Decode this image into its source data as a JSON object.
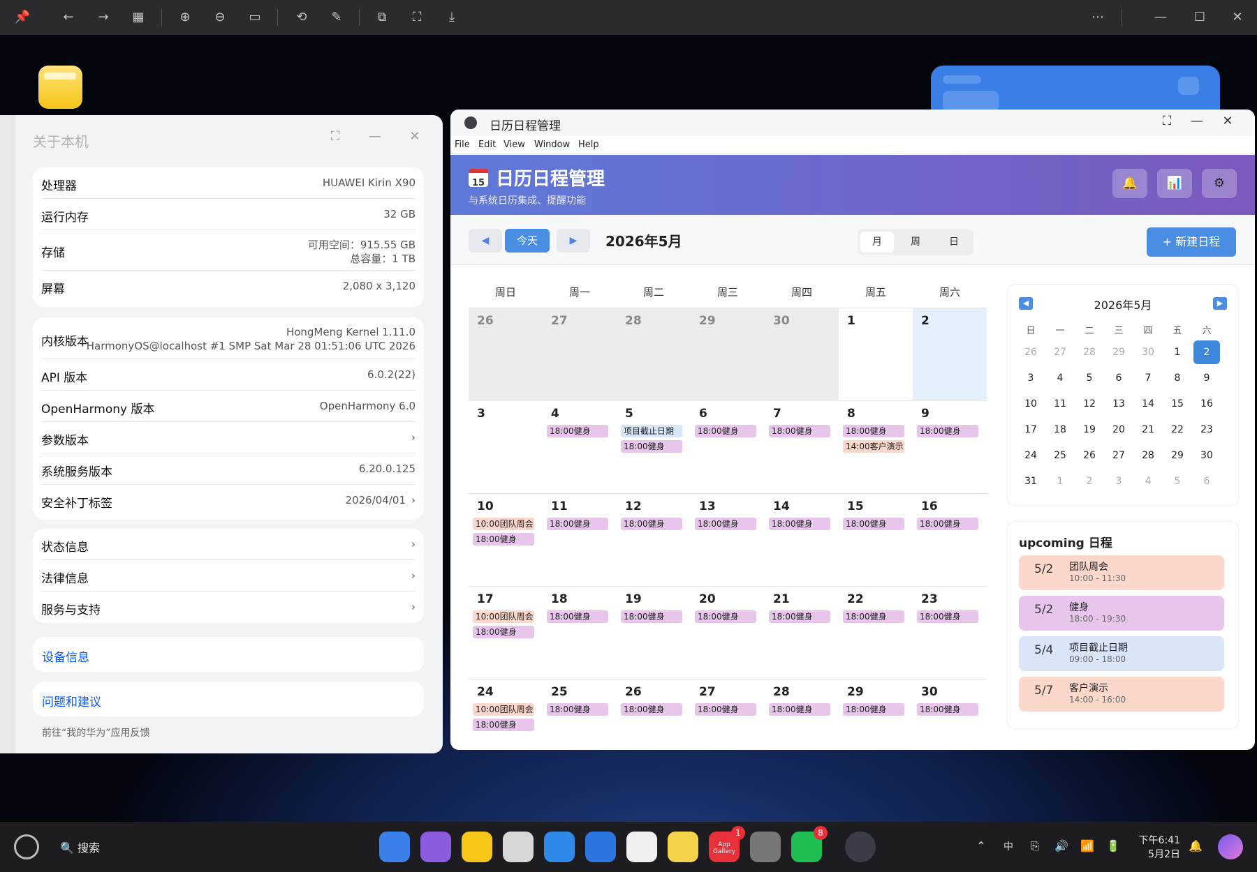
{
  "viewer_toolbar": {
    "icons": [
      "pin-icon",
      "back-icon",
      "forward-icon",
      "grid-icon",
      "zoom-in-icon",
      "zoom-out-icon",
      "fit-icon",
      "rotate-icon",
      "edit-icon",
      "crop-icon",
      "screenshot-icon",
      "download-icon",
      "more-icon",
      "minimize-icon",
      "maximize-icon",
      "close-icon"
    ]
  },
  "about": {
    "title": "关于本机",
    "card1": [
      {
        "k": "处理器",
        "v": "HUAWEI Kirin X90"
      },
      {
        "k": "运行内存",
        "v": "32 GB"
      },
      {
        "k": "存储",
        "v1": "可用空间：915.55 GB",
        "v2": "总容量：1 TB"
      },
      {
        "k": "屏幕",
        "v": "2,080 x 3,120"
      }
    ],
    "card2": [
      {
        "k": "内核版本",
        "v1": "HongMeng Kernel 1.11.0",
        "v2": "HarmonyOS@localhost #1 SMP Sat Mar 28 01:51:06 UTC 2026"
      },
      {
        "k": "API 版本",
        "v": "6.0.2(22)"
      },
      {
        "k": "OpenHarmony 版本",
        "v": "OpenHarmony 6.0"
      },
      {
        "k": "参数版本",
        "v": ""
      },
      {
        "k": "系统服务版本",
        "v": "6.20.0.125"
      },
      {
        "k": "安全补丁标签",
        "v": "2026/04/01"
      }
    ],
    "card3": [
      "状态信息",
      "法律信息",
      "服务与支持"
    ],
    "device_info": "设备信息",
    "feedback_link": "问题和建议",
    "feedback_note": "前往“我的华为”应用反馈"
  },
  "calendar": {
    "window_title": "日历日程管理",
    "menu": [
      "File",
      "Edit",
      "View",
      "Window",
      "Help"
    ],
    "logo_text": "15",
    "app_title": "日历日程管理",
    "subtitle": "与系统日历集成、提醒功能",
    "today": "今天",
    "month_title": "2026年5月",
    "views": [
      "月",
      "周",
      "日"
    ],
    "new_event": "+ 新建日程",
    "weekdays": [
      "周日",
      "周一",
      "周二",
      "周三",
      "周四",
      "周五",
      "周六"
    ],
    "weeks": [
      [
        {
          "d": "26",
          "t": "other"
        },
        {
          "d": "27",
          "t": "other"
        },
        {
          "d": "28",
          "t": "other"
        },
        {
          "d": "29",
          "t": "other"
        },
        {
          "d": "30",
          "t": "other"
        },
        {
          "d": "1"
        },
        {
          "d": "2",
          "t": "sel"
        }
      ],
      [
        {
          "d": "3"
        },
        {
          "d": "4",
          "ev": [
            [
              "gym",
              "18:00健身"
            ]
          ]
        },
        {
          "d": "5",
          "ev": [
            [
              "due",
              "项目截止日期"
            ],
            [
              "gym",
              "18:00健身"
            ]
          ]
        },
        {
          "d": "6",
          "ev": [
            [
              "gym",
              "18:00健身"
            ]
          ]
        },
        {
          "d": "7",
          "ev": [
            [
              "gym",
              "18:00健身"
            ]
          ]
        },
        {
          "d": "8",
          "ev": [
            [
              "gym",
              "18:00健身"
            ],
            [
              "meet",
              "14:00客户演示"
            ]
          ]
        },
        {
          "d": "9",
          "ev": [
            [
              "gym",
              "18:00健身"
            ]
          ]
        }
      ],
      [
        {
          "d": "10",
          "ev": [
            [
              "meet",
              "10:00团队周会"
            ],
            [
              "gym",
              "18:00健身"
            ]
          ]
        },
        {
          "d": "11",
          "ev": [
            [
              "gym",
              "18:00健身"
            ]
          ]
        },
        {
          "d": "12",
          "ev": [
            [
              "gym",
              "18:00健身"
            ]
          ]
        },
        {
          "d": "13",
          "ev": [
            [
              "gym",
              "18:00健身"
            ]
          ]
        },
        {
          "d": "14",
          "ev": [
            [
              "gym",
              "18:00健身"
            ]
          ]
        },
        {
          "d": "15",
          "ev": [
            [
              "gym",
              "18:00健身"
            ]
          ]
        },
        {
          "d": "16",
          "ev": [
            [
              "gym",
              "18:00健身"
            ]
          ]
        }
      ],
      [
        {
          "d": "17",
          "ev": [
            [
              "meet",
              "10:00团队周会"
            ],
            [
              "gym",
              "18:00健身"
            ]
          ]
        },
        {
          "d": "18",
          "ev": [
            [
              "gym",
              "18:00健身"
            ]
          ]
        },
        {
          "d": "19",
          "ev": [
            [
              "gym",
              "18:00健身"
            ]
          ]
        },
        {
          "d": "20",
          "ev": [
            [
              "gym",
              "18:00健身"
            ]
          ]
        },
        {
          "d": "21",
          "ev": [
            [
              "gym",
              "18:00健身"
            ]
          ]
        },
        {
          "d": "22",
          "ev": [
            [
              "gym",
              "18:00健身"
            ]
          ]
        },
        {
          "d": "23",
          "ev": [
            [
              "gym",
              "18:00健身"
            ]
          ]
        }
      ],
      [
        {
          "d": "24",
          "ev": [
            [
              "meet",
              "10:00团队周会"
            ],
            [
              "gym",
              "18:00健身"
            ]
          ]
        },
        {
          "d": "25",
          "ev": [
            [
              "gym",
              "18:00健身"
            ]
          ]
        },
        {
          "d": "26",
          "ev": [
            [
              "gym",
              "18:00健身"
            ]
          ]
        },
        {
          "d": "27",
          "ev": [
            [
              "gym",
              "18:00健身"
            ]
          ]
        },
        {
          "d": "28",
          "ev": [
            [
              "gym",
              "18:00健身"
            ]
          ]
        },
        {
          "d": "29",
          "ev": [
            [
              "gym",
              "18:00健身"
            ]
          ]
        },
        {
          "d": "30",
          "ev": [
            [
              "gym",
              "18:00健身"
            ]
          ]
        }
      ]
    ],
    "mini": {
      "title": "2026年5月",
      "heads": [
        "日",
        "一",
        "二",
        "三",
        "四",
        "五",
        "六"
      ],
      "days": [
        [
          "26",
          "27",
          "28",
          "29",
          "30",
          "1",
          "2"
        ],
        [
          "3",
          "4",
          "5",
          "6",
          "7",
          "8",
          "9"
        ],
        [
          "10",
          "11",
          "12",
          "13",
          "14",
          "15",
          "16"
        ],
        [
          "17",
          "18",
          "19",
          "20",
          "21",
          "22",
          "23"
        ],
        [
          "24",
          "25",
          "26",
          "27",
          "28",
          "29",
          "30"
        ],
        [
          "31",
          "1",
          "2",
          "3",
          "4",
          "5",
          "6"
        ]
      ],
      "selected": "2"
    },
    "upcoming_title": "upcoming 日程",
    "upcoming": [
      {
        "date": "5/2",
        "name": "团队周会",
        "time": "10:00 - 11:30",
        "color": "#fbd7cc"
      },
      {
        "date": "5/2",
        "name": "健身",
        "time": "18:00 - 19:30",
        "color": "#e8c6ec"
      },
      {
        "date": "5/4",
        "name": "项目截止日期",
        "time": "09:00 - 18:00",
        "color": "#d8e6f8"
      },
      {
        "date": "5/7",
        "name": "客户演示",
        "time": "14:00 - 16:00",
        "color": "#fbd7cc"
      }
    ]
  },
  "taskbar": {
    "search": "搜索",
    "badges": {
      "appgallery": "1",
      "wechat": "8"
    },
    "appgallery_label": "App Gallery",
    "ime": "中",
    "time": "下午6:41",
    "date": "5月2日"
  }
}
